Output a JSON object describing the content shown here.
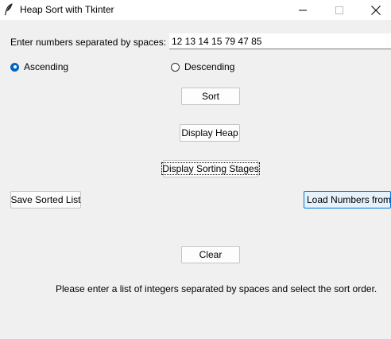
{
  "window": {
    "title": "Heap Sort with Tkinter",
    "minimize_glyph": "─",
    "maximize_glyph": "☐",
    "close_glyph": "✕",
    "icon": "feather-icon"
  },
  "input": {
    "label": "Enter numbers separated by spaces:",
    "value": "12 13 14 15 79 47 85"
  },
  "order": {
    "ascending_label": "Ascending",
    "descending_label": "Descending",
    "selected": "Ascending",
    "accent_color": "#0067c0"
  },
  "buttons": {
    "sort": "Sort",
    "display_heap": "Display Heap",
    "display_stages": "Display Sorting Stages",
    "save": "Save Sorted List",
    "load": "Load Numbers from File",
    "clear": "Clear"
  },
  "status": {
    "message": "Please enter a list of integers separated by spaces and select the sort order."
  }
}
